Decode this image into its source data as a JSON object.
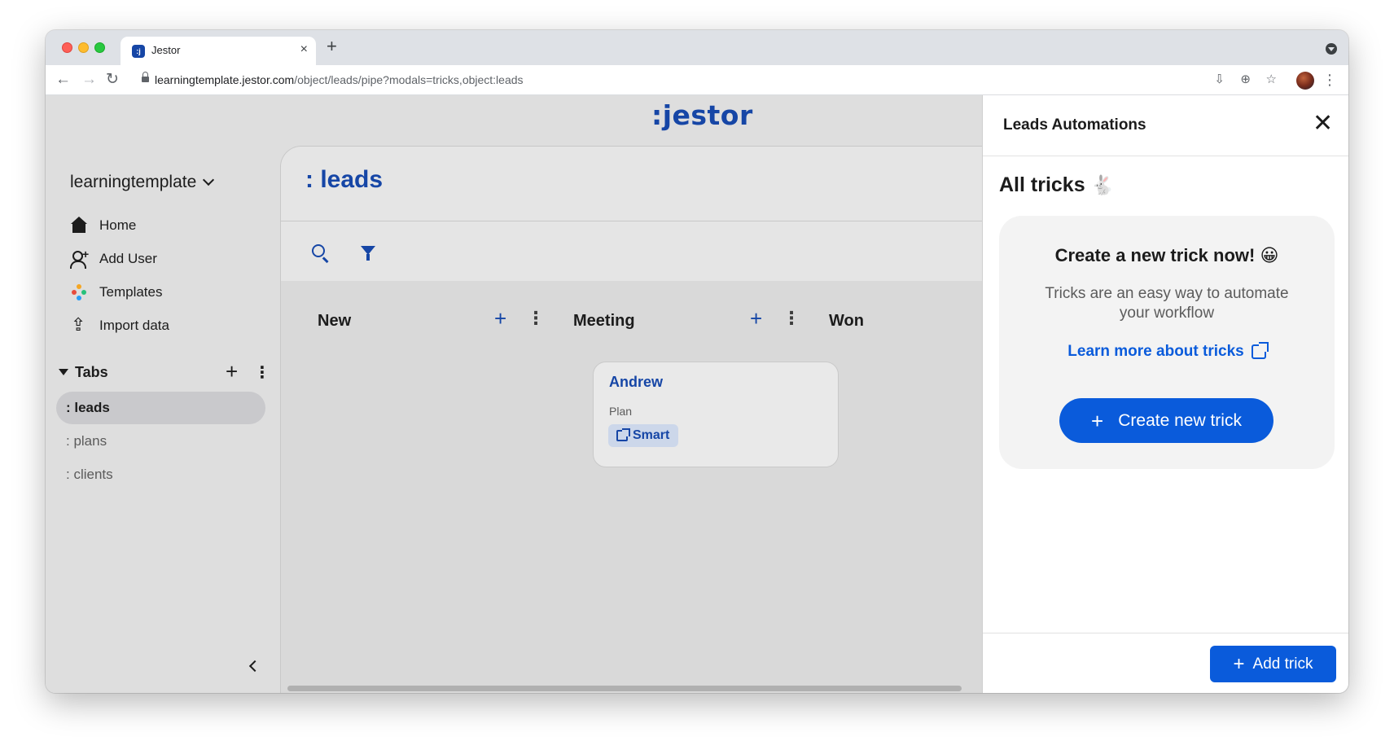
{
  "browser": {
    "tab_title": "Jestor",
    "favicon_text": ":j",
    "url_host": "learningtemplate.jestor.com",
    "url_path": "/object/leads/pipe?modals=tricks,object:leads"
  },
  "app": {
    "logo": ":jestor"
  },
  "sidebar": {
    "workspace": "learningtemplate",
    "nav": [
      {
        "label": "Home",
        "icon": "home-icon"
      },
      {
        "label": "Add User",
        "icon": "add-user-icon"
      },
      {
        "label": "Templates",
        "icon": "templates-icon"
      },
      {
        "label": "Import data",
        "icon": "upload-icon"
      }
    ],
    "tabs_heading": "Tabs",
    "tabs": [
      {
        "label": ": leads",
        "active": true
      },
      {
        "label": ": plans",
        "active": false
      },
      {
        "label": ": clients",
        "active": false
      }
    ]
  },
  "main": {
    "title": ": leads",
    "columns": [
      {
        "label": "New"
      },
      {
        "label": "Meeting"
      },
      {
        "label": "Won"
      }
    ],
    "card": {
      "name": "Andrew",
      "field_label": "Plan",
      "field_value": "Smart"
    }
  },
  "panel": {
    "title": "Leads Automations",
    "heading": "All tricks",
    "heading_emoji": "🐇",
    "cta_title": "Create a new trick now! 😀",
    "cta_description": "Tricks are an easy way to automate your workflow",
    "learn_more": "Learn more about tricks",
    "create_button": "Create new trick",
    "add_button": "Add trick"
  },
  "colors": {
    "brand_navy": "#1646a6",
    "primary_blue": "#0a5bdb"
  }
}
